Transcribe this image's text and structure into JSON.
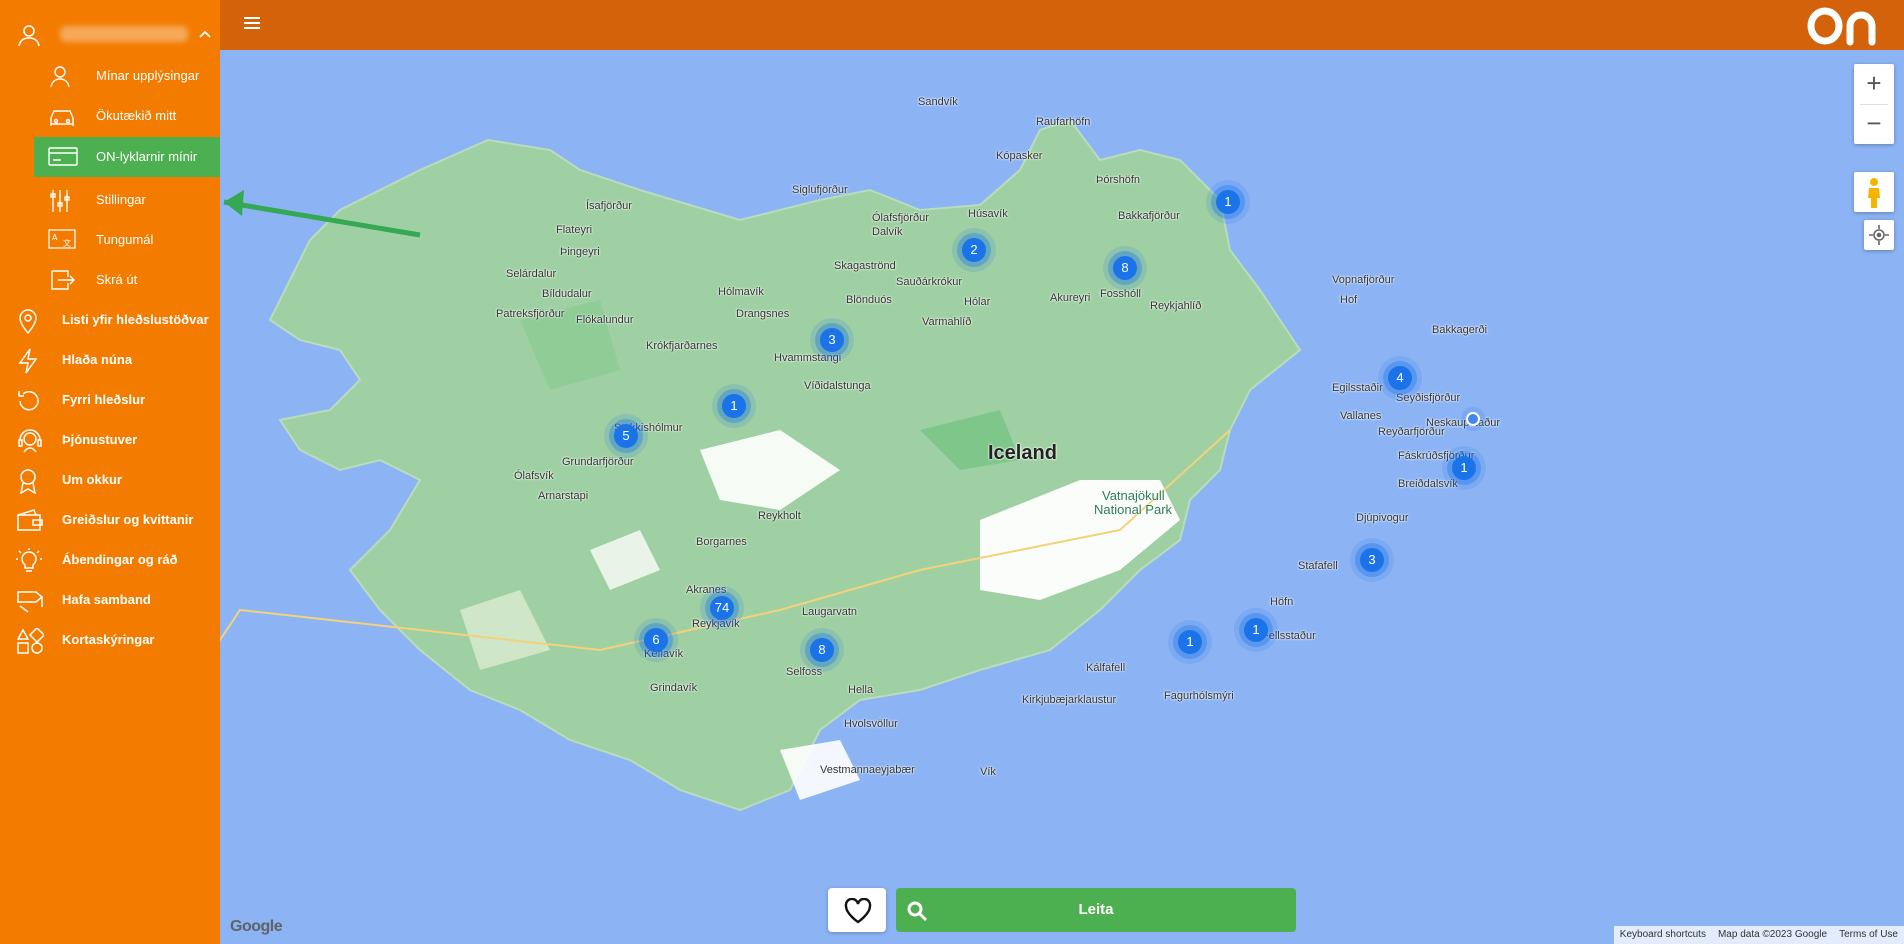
{
  "sidebar": {
    "user_menu": {
      "sub_items": [
        {
          "label": "Mínar upplýsingar",
          "icon": "user-icon"
        },
        {
          "label": "Ökutækið mitt",
          "icon": "car-icon"
        },
        {
          "label": "ON-lyklarnir mínir",
          "icon": "card-icon",
          "active": true
        },
        {
          "label": "Stillingar",
          "icon": "sliders-icon"
        },
        {
          "label": "Tungumál",
          "icon": "language-icon"
        },
        {
          "label": "Skrá út",
          "icon": "logout-icon"
        }
      ]
    },
    "items": [
      {
        "label": "Listi yfir hleðslustöðvar",
        "icon": "map-pin-icon"
      },
      {
        "label": "Hlaða núna",
        "icon": "bolt-icon"
      },
      {
        "label": "Fyrri hleðslur",
        "icon": "history-icon"
      },
      {
        "label": "Þjónustuver",
        "icon": "headset-icon"
      },
      {
        "label": "Um okkur",
        "icon": "award-icon"
      },
      {
        "label": "Greiðslur og kvittanir",
        "icon": "wallet-icon"
      },
      {
        "label": "Ábendingar og ráð",
        "icon": "lightbulb-icon"
      },
      {
        "label": "Hafa samband",
        "icon": "contact-icon"
      },
      {
        "label": "Kortaskýringar",
        "icon": "legend-icon"
      }
    ],
    "color": "#f37b00",
    "active_color": "#4caf50"
  },
  "header": {
    "logo_text": "on",
    "color": "#d4620a"
  },
  "map": {
    "country_label": "Iceland",
    "park_label_1": "Vatnajökull",
    "park_label_2": "National Park",
    "places": [
      "Sandvík",
      "Raufarhöfn",
      "Kópasker",
      "Þórshöfn",
      "Bakkafjörður",
      "Húsavík",
      "Siglufjörður",
      "Ólafsfjörður",
      "Dalvík",
      "Ísafjörður",
      "Flateyri",
      "Þingeyri",
      "Selárdalur",
      "Bíldudalur",
      "Patreksfjörður",
      "Flókalundur",
      "Hólmavík",
      "Drangsnes",
      "Skagaströnd",
      "Sauðárkrókur",
      "Hólar",
      "Blönduós",
      "Varmahlíð",
      "Akureyri",
      "Fosshóll",
      "Reykjahlíð",
      "Vopnafjörður",
      "Bakkagerði",
      "Hof",
      "Egilsstaðir",
      "Seyðisfjörður",
      "Neskaupstaður",
      "Vallanes",
      "Reyðarfjörður",
      "Fáskrúðsfjörður",
      "Breiðdalsvík",
      "Djúpivogur",
      "Stafafell",
      "Höfn",
      "Fellsstaður",
      "Kálfafell",
      "Fagurhólsmýri",
      "Kirkjubæjarklaustur",
      "Vík",
      "Vestmannaeyjabær",
      "Hvolsvöllur",
      "Hella",
      "Selfoss",
      "Reykholt",
      "Laugarvatn",
      "Reykjavík",
      "Akranes",
      "Keflavík",
      "Grindavík",
      "Borgarnes",
      "Krókfjarðarnes",
      "Hvammstangi",
      "Víðidalstunga",
      "Stykkishólmur",
      "Grundarfjörður",
      "Ólafsvík",
      "Arnarstapi"
    ],
    "clusters": [
      "1",
      "2",
      "8",
      "3",
      "1",
      "5",
      "4",
      "1",
      "3",
      "1",
      "1",
      "74",
      "6",
      "8"
    ]
  },
  "controls": {
    "zoom_in": "+",
    "zoom_out": "−",
    "search_label": "Leita",
    "favorites_icon": "heart-icon"
  },
  "attribution": {
    "google": "Google",
    "shortcuts": "Keyboard shortcuts",
    "map_data": "Map data ©2023 Google",
    "terms": "Terms of Use"
  }
}
